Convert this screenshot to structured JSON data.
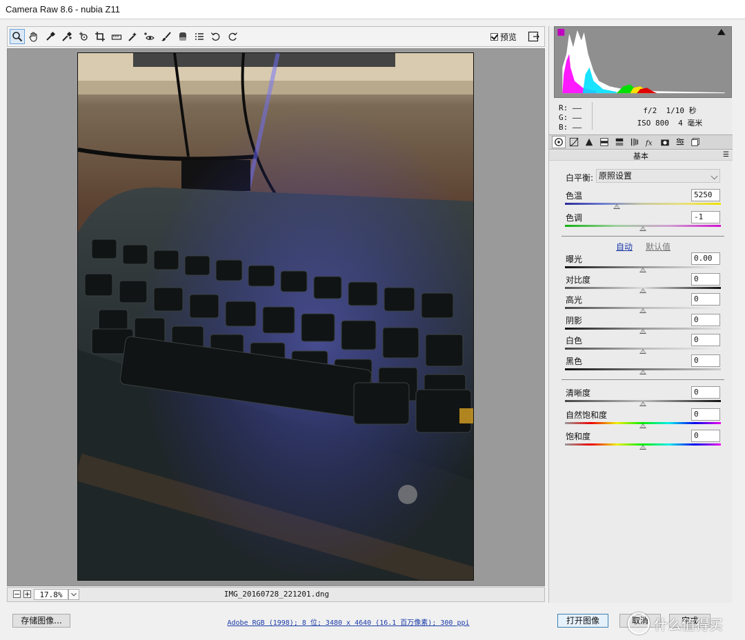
{
  "window": {
    "title": "Camera Raw 8.6 -  nubia Z11"
  },
  "toolbar": {
    "tools": [
      {
        "icon": "zoom-icon",
        "label": "缩放工具"
      },
      {
        "icon": "hand-icon",
        "label": "抓手工具"
      },
      {
        "icon": "white-balance-icon",
        "label": "白平衡工具"
      },
      {
        "icon": "color-sampler-icon",
        "label": "颜色取样器"
      },
      {
        "icon": "target-adjust-icon",
        "label": "目标调整"
      },
      {
        "icon": "crop-icon",
        "label": "裁剪"
      },
      {
        "icon": "straighten-icon",
        "label": "拉直"
      },
      {
        "icon": "spot-removal-icon",
        "label": "污点去除"
      },
      {
        "icon": "red-eye-icon",
        "label": "红眼去除"
      },
      {
        "icon": "brush-icon",
        "label": "调整画笔"
      },
      {
        "icon": "graduated-filter-icon",
        "label": "渐变滤镜"
      },
      {
        "icon": "list-icon",
        "label": "首选项"
      },
      {
        "icon": "rotate-left-icon",
        "label": "逆时针旋转"
      },
      {
        "icon": "rotate-right-icon",
        "label": "顺时针旋转"
      }
    ],
    "preview_label": "预览",
    "preview_checked": true
  },
  "status": {
    "zoom": "17.8%",
    "filename": "IMG_20160728_221201.dng"
  },
  "info": {
    "r_label": "R:",
    "g_label": "G:",
    "b_label": "B:",
    "dash": "——",
    "aperture": "f/2",
    "shutter": "1/10 秒",
    "iso": "ISO 800",
    "focal": "4 毫米"
  },
  "panel": {
    "tabs": [
      "basic-icon",
      "tone-curve-icon",
      "detail-icon",
      "hsl-icon",
      "split-tone-icon",
      "lens-icon",
      "fx-icon",
      "camera-calibration-icon",
      "presets-icon",
      "snapshots-icon"
    ],
    "title": "基本",
    "white_balance": {
      "label": "白平衡:",
      "value": "原照设置"
    },
    "temp": {
      "label": "色温",
      "value": "5250",
      "pos": 0.33
    },
    "tint": {
      "label": "色调",
      "value": "-1",
      "pos": 0.5
    },
    "auto_label": "自动",
    "default_label": "默认值",
    "tone": [
      {
        "label": "曝光",
        "value": "0.00",
        "pos": 0.5
      },
      {
        "label": "对比度",
        "value": "0",
        "pos": 0.5
      },
      {
        "label": "高光",
        "value": "0",
        "pos": 0.5
      },
      {
        "label": "阴影",
        "value": "0",
        "pos": 0.5
      },
      {
        "label": "白色",
        "value": "0",
        "pos": 0.5
      },
      {
        "label": "黑色",
        "value": "0",
        "pos": 0.5
      }
    ],
    "presence": [
      {
        "label": "清晰度",
        "value": "0",
        "pos": 0.5
      },
      {
        "label": "自然饱和度",
        "value": "0",
        "pos": 0.5
      },
      {
        "label": "饱和度",
        "value": "0",
        "pos": 0.5
      }
    ]
  },
  "footer": {
    "save_label": "存储图像...",
    "workflow": "Adobe RGB (1998); 8 位; 3480 x 4640 (16.1 百万像素); 300 ppi",
    "open_label": "打开图像",
    "cancel_label": "取消",
    "done_label": "完成",
    "watermark": "什么值得买"
  },
  "colors": {
    "accent": "#3c7fb1",
    "link": "#1a3aa8",
    "canvas_bg": "#9a9a9a"
  }
}
